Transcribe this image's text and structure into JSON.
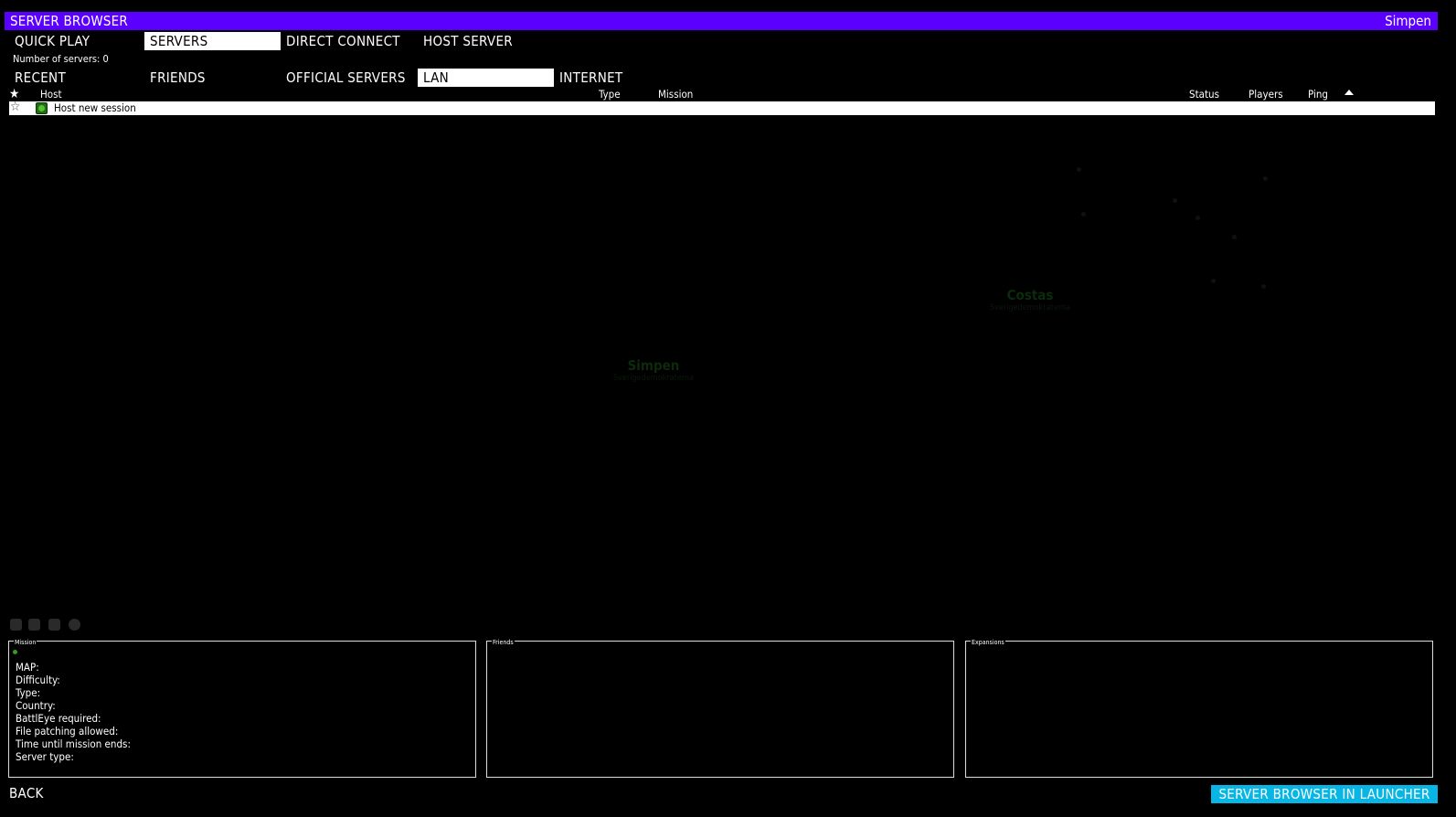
{
  "window": {
    "title": "SERVER BROWSER",
    "user": "Simpen"
  },
  "main_tabs": [
    {
      "label": "QUICK PLAY",
      "active": false
    },
    {
      "label": "SERVERS",
      "active": true
    },
    {
      "label": "DIRECT CONNECT",
      "active": false
    },
    {
      "label": "HOST SERVER",
      "active": false
    }
  ],
  "server_count": "Number of servers: 0",
  "filter_tabs": [
    {
      "label": "RECENT",
      "active": false
    },
    {
      "label": "FRIENDS",
      "active": false
    },
    {
      "label": "OFFICIAL SERVERS",
      "active": false
    },
    {
      "label": "LAN",
      "active": true
    },
    {
      "label": "INTERNET",
      "active": false
    }
  ],
  "columns": {
    "host": "Host",
    "type": "Type",
    "mission": "Mission",
    "status": "Status",
    "players": "Players",
    "ping": "Ping"
  },
  "rows": [
    {
      "host": "Host new session",
      "favorite": false
    }
  ],
  "map_labels": [
    {
      "name": "Costas",
      "group": "Sverigedemokraterna"
    },
    {
      "name": "Simpen",
      "group": "Sverigedemokraterna"
    }
  ],
  "panels": {
    "mission": {
      "title": "Mission",
      "fields": [
        "MAP:",
        "Difficulty:",
        "Type:",
        "Country:",
        "BattlEye required:",
        "File patching allowed:",
        "Time until mission ends:",
        "Server type:"
      ]
    },
    "friends": {
      "title": "Friends"
    },
    "expansions": {
      "title": "Expansions"
    }
  },
  "footer": {
    "back": "BACK",
    "launcher": "SERVER BROWSER IN LAUNCHER"
  },
  "colors": {
    "title_bar": "#5b00ff",
    "launcher_button": "#08b6e6",
    "active_tab": "#ffffff"
  }
}
